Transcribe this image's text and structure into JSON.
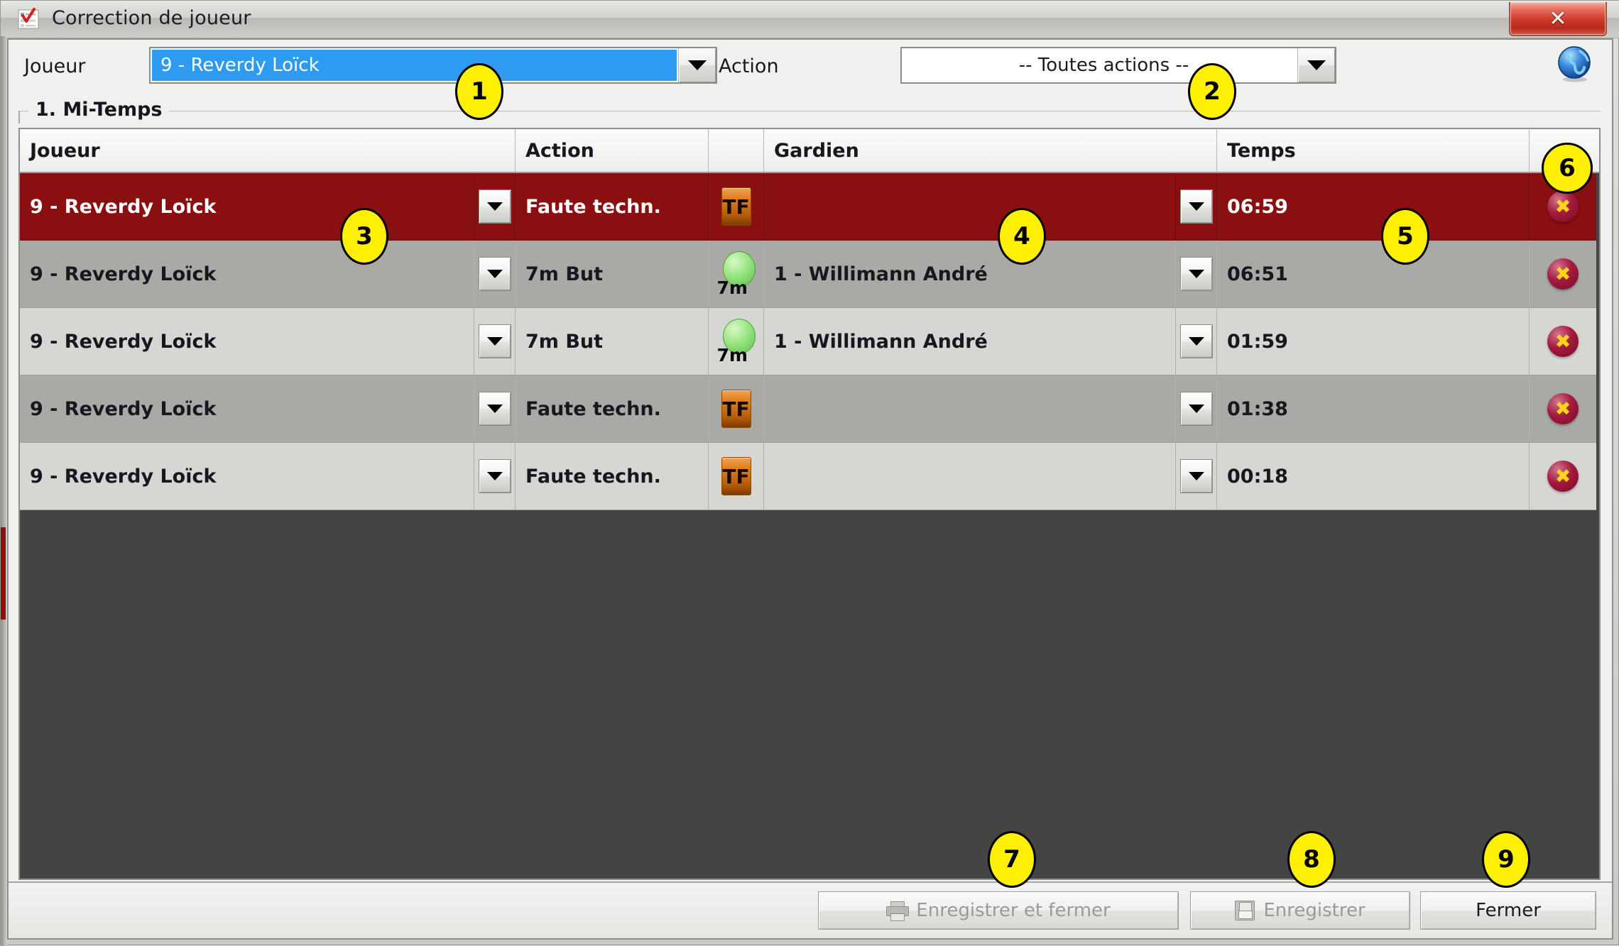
{
  "window": {
    "title": "Correction de joueur",
    "title_icon": "checklist-document-icon",
    "close_glyph": "✕"
  },
  "filters": {
    "joueur_label": "Joueur",
    "joueur_value": "9 - Reverdy Loïck",
    "joueur_icon": "chevron-down-icon",
    "action_label": "Action",
    "action_value": "-- Toutes actions --",
    "action_icon": "chevron-down-icon",
    "globe_icon": "globe-icon"
  },
  "group": {
    "title": "1. Mi-Temps"
  },
  "table": {
    "headers": {
      "joueur": "Joueur",
      "action": "Action",
      "action_icon": "",
      "gardien": "Gardien",
      "temps": "Temps",
      "delete": ""
    },
    "rows": [
      {
        "joueur": "9 - Reverdy Loïck",
        "joueur_btn_icon": "chevron-down-icon",
        "action": "Faute techn.",
        "action_icon": "technical-foul-icon",
        "action_icon_label": "TF",
        "gardien": "",
        "gardien_btn_icon": "chevron-down-icon",
        "temps": "06:59",
        "delete_icon": "delete-row-icon",
        "state": "selected"
      },
      {
        "joueur": "9 - Reverdy Loïck",
        "joueur_btn_icon": "chevron-down-icon",
        "action": "7m But",
        "action_icon": "seven-meter-goal-icon",
        "action_icon_label": "7m",
        "gardien": "1 - Willimann André",
        "gardien_btn_icon": "chevron-down-icon",
        "temps": "06:51",
        "delete_icon": "delete-row-icon",
        "state": "alt-dark"
      },
      {
        "joueur": "9 - Reverdy Loïck",
        "joueur_btn_icon": "chevron-down-icon",
        "action": "7m But",
        "action_icon": "seven-meter-goal-icon",
        "action_icon_label": "7m",
        "gardien": "1 - Willimann André",
        "gardien_btn_icon": "chevron-down-icon",
        "temps": "01:59",
        "delete_icon": "delete-row-icon",
        "state": "alt-light"
      },
      {
        "joueur": "9 - Reverdy Loïck",
        "joueur_btn_icon": "chevron-down-icon",
        "action": "Faute techn.",
        "action_icon": "technical-foul-icon",
        "action_icon_label": "TF",
        "gardien": "",
        "gardien_btn_icon": "chevron-down-icon",
        "temps": "01:38",
        "delete_icon": "delete-row-icon",
        "state": "alt-dark"
      },
      {
        "joueur": "9 - Reverdy Loïck",
        "joueur_btn_icon": "chevron-down-icon",
        "action": "Faute techn.",
        "action_icon": "technical-foul-icon",
        "action_icon_label": "TF",
        "gardien": "",
        "gardien_btn_icon": "chevron-down-icon",
        "temps": "00:18",
        "delete_icon": "delete-row-icon",
        "state": "alt-light"
      }
    ]
  },
  "buttons": {
    "save_and_close": "Enregistrer et fermer",
    "save_and_close_icon": "printer-icon",
    "save_and_close_enabled": false,
    "save": "Enregistrer",
    "save_icon": "floppy-disk-icon",
    "save_enabled": false,
    "close": "Fermer",
    "close_enabled": true
  },
  "markers": [
    {
      "n": "1"
    },
    {
      "n": "2"
    },
    {
      "n": "3"
    },
    {
      "n": "4"
    },
    {
      "n": "5"
    },
    {
      "n": "6"
    },
    {
      "n": "7"
    },
    {
      "n": "8"
    },
    {
      "n": "9"
    }
  ],
  "colors": {
    "selected_row": "#8a0f10",
    "row_dark": "#a9a9a6",
    "row_light": "#d6d6d3",
    "empty_area": "#444444",
    "combo_highlight": "#2f9bf0",
    "marker_fill": "#ffef00",
    "action_icon_tf": "#e07f1e",
    "action_icon_7m": "#95e37e"
  }
}
